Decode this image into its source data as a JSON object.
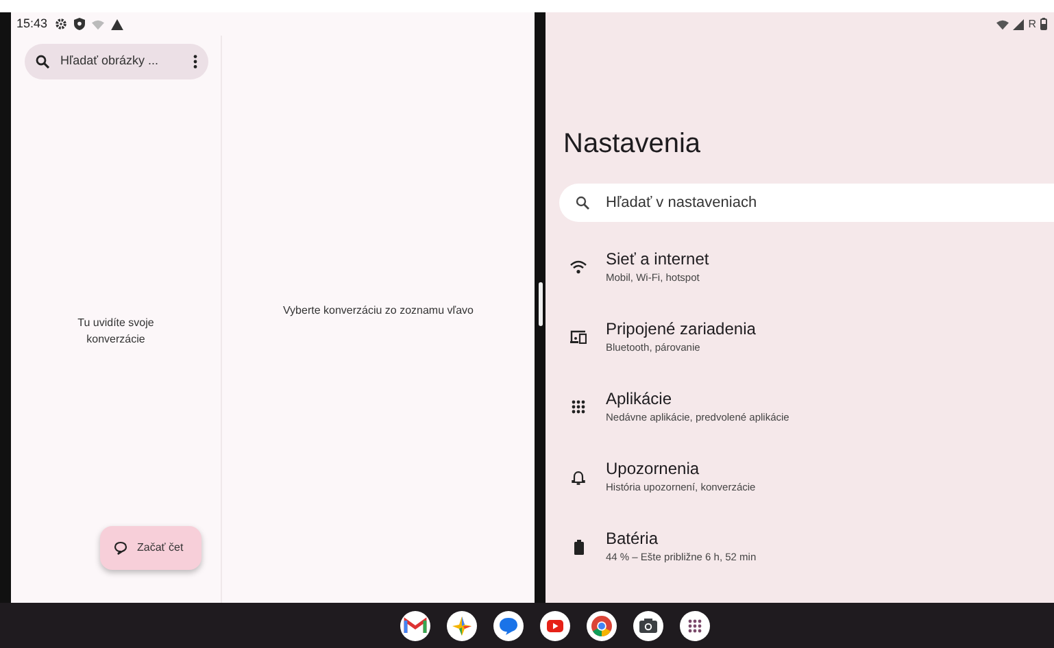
{
  "status_bar": {
    "time": "15:43",
    "network_label": "R"
  },
  "messages": {
    "search": {
      "placeholder": "Hľadať obrázky ..."
    },
    "empty_list": "Tu uvidíte svoje konverzácie",
    "empty_detail": "Vyberte konverzáciu zo zoznamu vľavo",
    "fab": {
      "label": "Začať čet"
    }
  },
  "settings": {
    "title": "Nastavenia",
    "search": {
      "placeholder": "Hľadať v nastaveniach"
    },
    "items": [
      {
        "kind": "wifi",
        "title": "Sieť a internet",
        "subtitle": "Mobil, Wi-Fi, hotspot"
      },
      {
        "kind": "devices",
        "title": "Pripojené zariadenia",
        "subtitle": "Bluetooth, párovanie"
      },
      {
        "kind": "apps",
        "title": "Aplikácie",
        "subtitle": "Nedávne aplikácie, predvolené aplikácie"
      },
      {
        "kind": "bell",
        "title": "Upozornenia",
        "subtitle": "História upozornení, konverzácie"
      },
      {
        "kind": "battery",
        "title": "Batéria",
        "subtitle": "44 % – Ešte približne 6 h, 52 min"
      }
    ]
  },
  "taskbar": {
    "apps": [
      {
        "kind": "mail"
      },
      {
        "kind": "star"
      },
      {
        "kind": "chat"
      },
      {
        "kind": "video"
      },
      {
        "kind": "browser"
      },
      {
        "kind": "camera"
      },
      {
        "kind": "grid"
      }
    ]
  }
}
